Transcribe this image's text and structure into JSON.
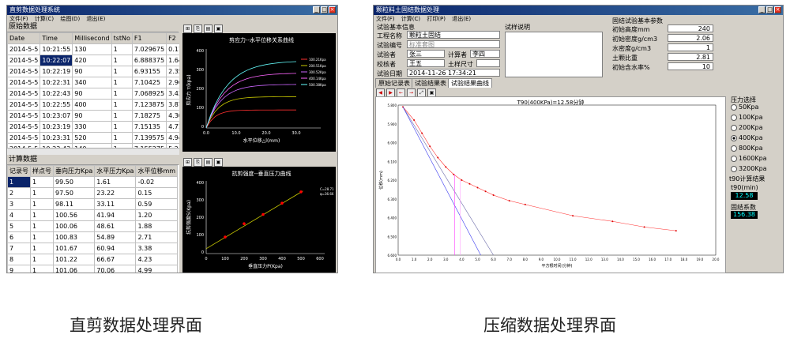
{
  "left": {
    "title": "直剪数据处理系统",
    "menu": [
      "文件(F)",
      "计算(C)",
      "绘图(D)",
      "退出(E)"
    ],
    "raw_section": "原始数据",
    "raw_columns": [
      "Date",
      "Time",
      "Millisecond",
      "tstNo",
      "F1",
      "F2"
    ],
    "raw_rows": [
      [
        "2014-5-5",
        "10:21:55",
        "130",
        "1",
        "7.029675",
        "0.1138"
      ],
      [
        "2014-5-5",
        "10:22:07",
        "420",
        "1",
        "6.888375",
        "1.6406"
      ],
      [
        "2014-5-5",
        "10:22:19",
        "90",
        "1",
        "6.93155",
        "2.3593"
      ],
      [
        "2014-5-5",
        "10:22:31",
        "340",
        "1",
        "7.10425",
        "2.9653"
      ],
      [
        "2014-5-5",
        "10:22:43",
        "90",
        "1",
        "7.068925",
        "3.4343"
      ],
      [
        "2014-5-5",
        "10:22:55",
        "400",
        "1",
        "7.123875",
        "3.8779"
      ],
      [
        "2014-5-5",
        "10:23:07",
        "90",
        "1",
        "7.18275",
        "4.3057"
      ],
      [
        "2014-5-5",
        "10:23:19",
        "330",
        "1",
        "7.15135",
        "4.71"
      ],
      [
        "2014-5-5",
        "10:23:31",
        "520",
        "1",
        "7.139575",
        "4.9494"
      ],
      [
        "2014-5-5",
        "10:23:43",
        "140",
        "1",
        "7.155275",
        "5.2458"
      ]
    ],
    "calc_section": "计算数据",
    "calc_columns": [
      "记录号",
      "样点号",
      "垂向压力Kpa",
      "水平压力Kpa",
      "水平位移mm"
    ],
    "calc_rows": [
      [
        "1",
        "1",
        "99.50",
        "1.61",
        "-0.02"
      ],
      [
        "2",
        "1",
        "97.50",
        "23.22",
        "0.15"
      ],
      [
        "3",
        "1",
        "98.11",
        "33.11",
        "0.59"
      ],
      [
        "4",
        "1",
        "100.56",
        "41.94",
        "1.20"
      ],
      [
        "5",
        "1",
        "100.06",
        "48.61",
        "1.88"
      ],
      [
        "6",
        "1",
        "100.83",
        "54.89",
        "2.71"
      ],
      [
        "7",
        "1",
        "101.67",
        "60.94",
        "3.38"
      ],
      [
        "8",
        "1",
        "101.22",
        "66.67",
        "4.23"
      ],
      [
        "9",
        "1",
        "101.06",
        "70.06",
        "4.99"
      ]
    ],
    "chart1": {
      "title": "剪应力--水平位移关系曲线",
      "xlabel": "水平位移△l(mm)",
      "ylabel": "剪应力 τ(kpa)",
      "legend": [
        "100.21Kpa",
        "200.51Kpa",
        "300.52Kpa",
        "400.14Kpa",
        "500.38Kpa"
      ],
      "colors": [
        "#ff3030",
        "#c8c800",
        "#cc66ff",
        "#ff66ff",
        "#66ffff"
      ],
      "xticks": [
        "0.0",
        "10.0",
        "20.0",
        "30.0"
      ],
      "yticks": [
        "0",
        "100",
        "200",
        "300",
        "400"
      ]
    },
    "chart2": {
      "title": "抗剪强度--垂直压力曲线",
      "xlabel": "垂直压力P(Kpa)",
      "ylabel": "抗剪强度S(Kpa)",
      "note": [
        "C=28.71",
        "φ=36.66"
      ],
      "xticks": [
        "0",
        "100",
        "200",
        "300",
        "400",
        "500",
        "600"
      ],
      "yticks": [
        "0",
        "100",
        "200",
        "300",
        "400"
      ]
    }
  },
  "right": {
    "title": "颗粒料土固结数据处理",
    "menu": [
      "文件(F)",
      "计算(C)",
      "打印(P)",
      "退出(E)"
    ],
    "basic_section": "试验基本信息",
    "fields": [
      {
        "label": "工程名称",
        "value": "颗粒土固结"
      },
      {
        "label": "试验编号",
        "value": "标准套图"
      },
      {
        "label": "试验者",
        "value": "张三"
      },
      {
        "label": "校核者",
        "value": "王五"
      },
      {
        "label": "试验日期",
        "value": "2014-11-26 17:34:21"
      }
    ],
    "calc_label": "计算者",
    "calc_value": "李四",
    "size_label": "土样尺寸",
    "notes_label": "试样说明",
    "params_section": "固结试验基本参数",
    "params": [
      {
        "label": "初始高度mm",
        "value": "240"
      },
      {
        "label": "初始密度g/cm3",
        "value": "2.06"
      },
      {
        "label": "水密度g/cm3",
        "value": "1"
      },
      {
        "label": "土颗比重",
        "value": "2.81"
      },
      {
        "label": "初始含水率%",
        "value": "10"
      }
    ],
    "tabs": [
      "原始记录表",
      "试验结果表",
      "试验结果曲线"
    ],
    "chart": {
      "title": "T90(400KPa)=12.58分钟",
      "xlabel": "平方根时间(分钟)",
      "ylabel": "位移(mm)",
      "xticks": [
        "0.0",
        "1.0",
        "2.0",
        "3.0",
        "4.0",
        "5.0",
        "6.0",
        "7.0",
        "8.0",
        "9.0",
        "10.0",
        "11.0",
        "12.0",
        "13.0",
        "14.0",
        "15.0",
        "16.0",
        "17.0",
        "18.0",
        "19.0",
        "20.0"
      ],
      "yticks": [
        "5.800",
        "5.900",
        "6.000",
        "6.100",
        "6.200",
        "6.300",
        "6.400",
        "6.500",
        "6.600"
      ]
    },
    "pressure_label": "压力选择",
    "pressures": [
      "50Kpa",
      "100Kpa",
      "200Kpa",
      "400Kpa",
      "800Kpa",
      "1600Kpa",
      "3200Kpa"
    ],
    "selected_pressure": "400Kpa",
    "t90_section": "t90计算结果",
    "t90_label": "t90(min)",
    "t90_value": "12.58",
    "cv_label": "固结系数",
    "cv_value": "156.38"
  },
  "captions": {
    "left": "直剪数据处理界面",
    "right": "压缩数据处理界面"
  }
}
